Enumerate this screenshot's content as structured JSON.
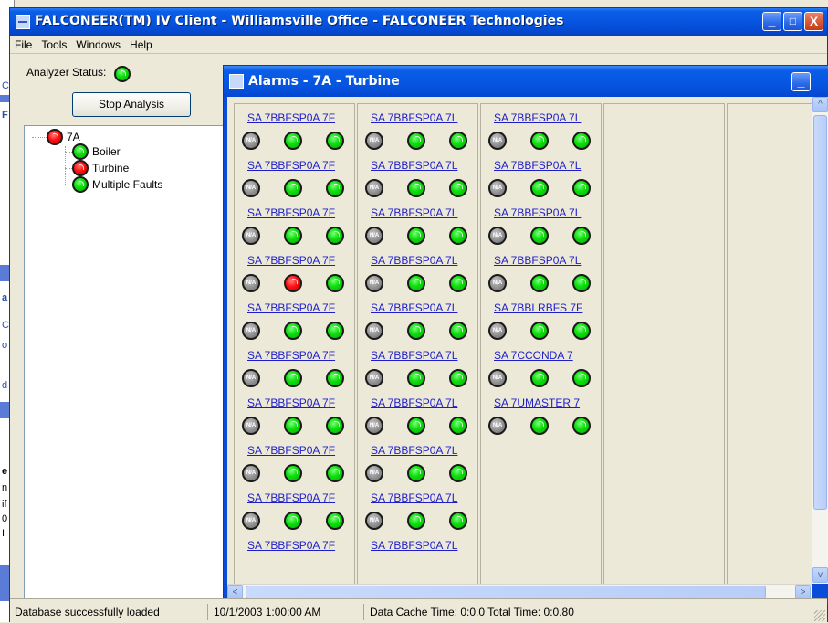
{
  "window": {
    "title": "FALCONEER(TM) IV Client - Williamsville Office - FALCONEER Technologies",
    "min_label": "_",
    "max_label": "□",
    "close_label": "X"
  },
  "background_fragments": [
    "C",
    "F",
    "a",
    "C",
    "o",
    "d",
    "e",
    "n",
    "if",
    "0",
    "I"
  ],
  "menu": [
    "File",
    "Tools",
    "Windows",
    "Help"
  ],
  "analyzer": {
    "label": "Analyzer Status:",
    "status": "green",
    "stop_button": "Stop Analysis"
  },
  "tree": {
    "root": {
      "label": "7A",
      "status": "red"
    },
    "children": [
      {
        "label": "Boiler",
        "status": "green"
      },
      {
        "label": "Turbine",
        "status": "red"
      },
      {
        "label": "Multiple Faults",
        "status": "green"
      }
    ]
  },
  "alarm_window": {
    "title": "Alarms - 7A - Turbine",
    "min_label": "_",
    "columns": [
      {
        "items": [
          {
            "tag": "SA 7BBFSP0A 7F",
            "leds": [
              "na",
              "green",
              "green"
            ]
          },
          {
            "tag": "SA 7BBFSP0A 7F",
            "leds": [
              "na",
              "green",
              "green"
            ]
          },
          {
            "tag": "SA 7BBFSP0A 7F",
            "leds": [
              "na",
              "green",
              "green"
            ]
          },
          {
            "tag": "SA 7BBFSP0A 7F",
            "leds": [
              "na",
              "red",
              "green"
            ]
          },
          {
            "tag": "SA 7BBFSP0A 7F",
            "leds": [
              "na",
              "green",
              "green"
            ]
          },
          {
            "tag": "SA 7BBFSP0A 7F",
            "leds": [
              "na",
              "green",
              "green"
            ]
          },
          {
            "tag": "SA 7BBFSP0A 7F",
            "leds": [
              "na",
              "green",
              "green"
            ]
          },
          {
            "tag": "SA 7BBFSP0A 7F",
            "leds": [
              "na",
              "green",
              "green"
            ]
          },
          {
            "tag": "SA 7BBFSP0A 7F",
            "leds": [
              "na",
              "green",
              "green"
            ]
          },
          {
            "tag": "SA 7BBFSP0A 7F",
            "leds": []
          }
        ]
      },
      {
        "items": [
          {
            "tag": "SA 7BBFSP0A 7L",
            "leds": [
              "na",
              "green",
              "green"
            ]
          },
          {
            "tag": "SA 7BBFSP0A 7L",
            "leds": [
              "na",
              "green",
              "green"
            ]
          },
          {
            "tag": "SA 7BBFSP0A 7L",
            "leds": [
              "na",
              "green",
              "green"
            ]
          },
          {
            "tag": "SA 7BBFSP0A 7L",
            "leds": [
              "na",
              "green",
              "green"
            ]
          },
          {
            "tag": "SA 7BBFSP0A 7L",
            "leds": [
              "na",
              "green",
              "green"
            ]
          },
          {
            "tag": "SA 7BBFSP0A 7L",
            "leds": [
              "na",
              "green",
              "green"
            ]
          },
          {
            "tag": "SA 7BBFSP0A 7L",
            "leds": [
              "na",
              "green",
              "green"
            ]
          },
          {
            "tag": "SA 7BBFSP0A 7L",
            "leds": [
              "na",
              "green",
              "green"
            ]
          },
          {
            "tag": "SA 7BBFSP0A 7L",
            "leds": [
              "na",
              "green",
              "green"
            ]
          },
          {
            "tag": "SA 7BBFSP0A 7L",
            "leds": []
          }
        ]
      },
      {
        "items": [
          {
            "tag": "SA 7BBFSP0A 7L",
            "leds": [
              "na",
              "green",
              "green"
            ]
          },
          {
            "tag": "SA 7BBFSP0A 7L",
            "leds": [
              "na",
              "green",
              "green"
            ]
          },
          {
            "tag": "SA 7BBFSP0A 7L",
            "leds": [
              "na",
              "green",
              "green"
            ]
          },
          {
            "tag": "SA 7BBFSP0A 7L",
            "leds": [
              "na",
              "green",
              "green"
            ]
          },
          {
            "tag": "SA 7BBLRBFS 7F",
            "leds": [
              "na",
              "green",
              "green"
            ]
          },
          {
            "tag": "SA 7CCONDA 7",
            "leds": [
              "na",
              "green",
              "green"
            ]
          },
          {
            "tag": "SA 7UMASTER 7",
            "leds": [
              "na",
              "green",
              "green"
            ]
          }
        ]
      },
      {
        "items": []
      },
      {
        "items": []
      }
    ],
    "na_label": "N/A",
    "scroll_left": "<",
    "scroll_right": ">",
    "scroll_up": "^",
    "scroll_down": "v"
  },
  "status_bar": {
    "message": "Database successfully loaded",
    "datetime": "10/1/2003 1:00:00 AM",
    "timing": "Data Cache Time: 0:0.0 Total Time: 0:0.80"
  },
  "colors": {
    "titlebar": "#0655e0",
    "led_green": "#10e010",
    "led_red": "#ff1010",
    "led_na": "#8a8a8a",
    "link": "#1e1ec8"
  }
}
